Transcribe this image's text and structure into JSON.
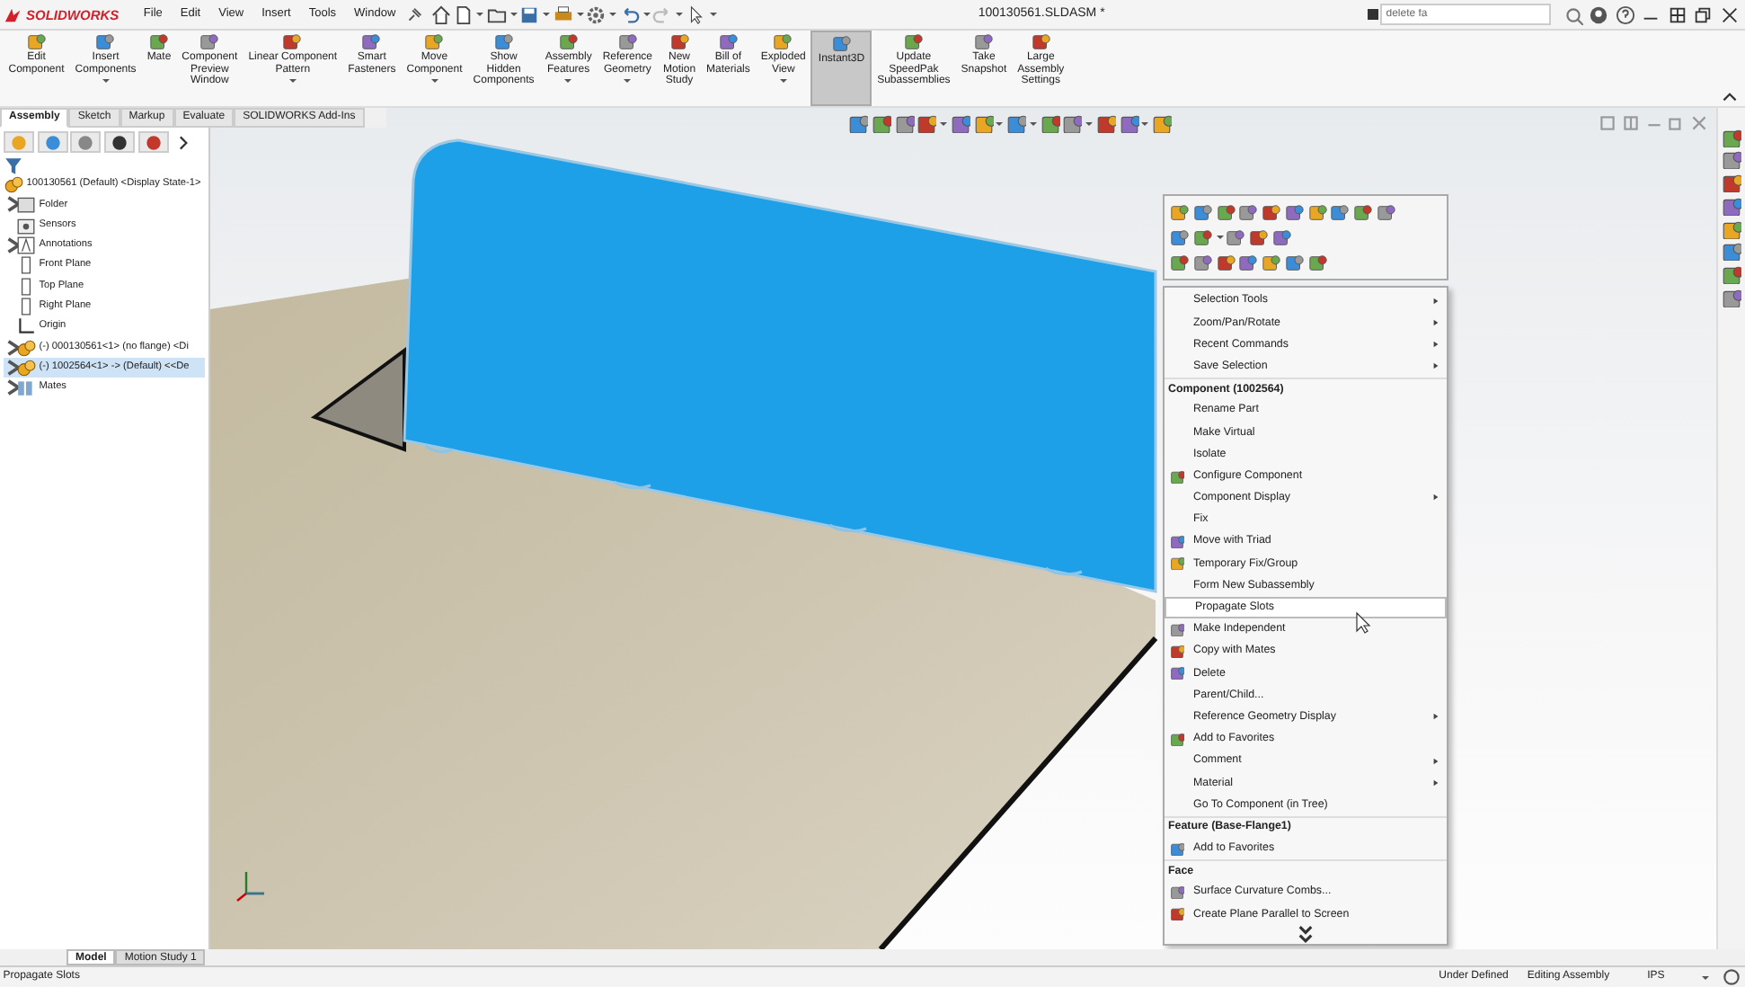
{
  "app": {
    "logo": "SOLIDWORKS",
    "menus": [
      "File",
      "Edit",
      "View",
      "Insert",
      "Tools",
      "Window"
    ],
    "document_title": "100130561.SLDASM *",
    "search": {
      "value": "delete fa"
    }
  },
  "ribbon": {
    "buttons": [
      {
        "label": "Edit\nComponent",
        "dropdown": false,
        "selected": false
      },
      {
        "label": "Insert\nComponents",
        "dropdown": true,
        "selected": false
      },
      {
        "label": "Mate",
        "dropdown": false,
        "selected": false
      },
      {
        "label": "Component\nPreview\nWindow",
        "dropdown": false,
        "selected": false
      },
      {
        "label": "Linear Component\nPattern",
        "dropdown": true,
        "selected": false
      },
      {
        "label": "Smart\nFasteners",
        "dropdown": false,
        "selected": false
      },
      {
        "label": "Move\nComponent",
        "dropdown": true,
        "selected": false
      },
      {
        "label": "Show\nHidden\nComponents",
        "dropdown": false,
        "selected": false
      },
      {
        "label": "Assembly\nFeatures",
        "dropdown": true,
        "selected": false
      },
      {
        "label": "Reference\nGeometry",
        "dropdown": true,
        "selected": false
      },
      {
        "label": "New\nMotion\nStudy",
        "dropdown": false,
        "selected": false
      },
      {
        "label": "Bill of\nMaterials",
        "dropdown": false,
        "selected": false
      },
      {
        "label": "Exploded\nView",
        "dropdown": true,
        "selected": false
      },
      {
        "label": "Instant3D",
        "dropdown": false,
        "selected": true
      },
      {
        "label": "Update\nSpeedPak\nSubassemblies",
        "dropdown": false,
        "selected": false
      },
      {
        "label": "Take\nSnapshot",
        "dropdown": false,
        "selected": false
      },
      {
        "label": "Large\nAssembly\nSettings",
        "dropdown": false,
        "selected": false
      }
    ]
  },
  "command_tabs": [
    {
      "label": "Assembly",
      "selected": true
    },
    {
      "label": "Sketch",
      "selected": false
    },
    {
      "label": "Markup",
      "selected": false
    },
    {
      "label": "Evaluate",
      "selected": false
    },
    {
      "label": "SOLIDWORKS Add-Ins",
      "selected": false
    }
  ],
  "feature_tree": {
    "root": {
      "label": "100130561 (Default) <Display State-1>",
      "selected": false,
      "children": [
        {
          "kind": "folder",
          "label": "Folder",
          "expandable": true,
          "selected": false
        },
        {
          "kind": "sensor",
          "label": "Sensors",
          "expandable": false,
          "selected": false
        },
        {
          "kind": "annotation",
          "label": "Annotations",
          "expandable": true,
          "selected": false
        },
        {
          "kind": "plane",
          "label": "Front Plane",
          "expandable": false,
          "selected": false
        },
        {
          "kind": "plane",
          "label": "Top Plane",
          "expandable": false,
          "selected": false
        },
        {
          "kind": "plane",
          "label": "Right Plane",
          "expandable": false,
          "selected": false
        },
        {
          "kind": "origin",
          "label": "Origin",
          "expandable": false,
          "selected": false
        },
        {
          "kind": "component",
          "label": "(-) 000130561<1> (no flange) <Di",
          "expandable": true,
          "selected": false
        },
        {
          "kind": "component",
          "label": "(-) 1002564<1> -> (Default) <<De",
          "expandable": true,
          "selected": true
        },
        {
          "kind": "mates",
          "label": "Mates",
          "expandable": true,
          "selected": false
        }
      ]
    }
  },
  "context_menu": {
    "items": [
      {
        "kind": "item",
        "label": "Selection Tools",
        "submenu": true,
        "icon": false,
        "selected": false
      },
      {
        "kind": "item",
        "label": "Zoom/Pan/Rotate",
        "submenu": true,
        "icon": false,
        "selected": false
      },
      {
        "kind": "item",
        "label": "Recent Commands",
        "submenu": true,
        "icon": false,
        "selected": false
      },
      {
        "kind": "item",
        "label": "Save Selection",
        "submenu": true,
        "icon": false,
        "selected": false
      },
      {
        "kind": "header",
        "label": "Component (1002564)"
      },
      {
        "kind": "item",
        "label": "Rename Part",
        "submenu": false,
        "icon": false,
        "selected": false
      },
      {
        "kind": "item",
        "label": "Make Virtual",
        "submenu": false,
        "icon": false,
        "selected": false
      },
      {
        "kind": "item",
        "label": "Isolate",
        "submenu": false,
        "icon": false,
        "selected": false
      },
      {
        "kind": "item",
        "label": "Configure Component",
        "submenu": false,
        "icon": true,
        "selected": false
      },
      {
        "kind": "item",
        "label": "Component Display",
        "submenu": true,
        "icon": false,
        "selected": false
      },
      {
        "kind": "item",
        "label": "Fix",
        "submenu": false,
        "icon": false,
        "selected": false
      },
      {
        "kind": "item",
        "label": "Move with Triad",
        "submenu": false,
        "icon": true,
        "selected": false
      },
      {
        "kind": "item",
        "label": "Temporary Fix/Group",
        "submenu": false,
        "icon": true,
        "selected": false
      },
      {
        "kind": "item",
        "label": "Form New Subassembly",
        "submenu": false,
        "icon": false,
        "selected": false
      },
      {
        "kind": "item",
        "label": "Propagate Slots",
        "submenu": false,
        "icon": false,
        "selected": true
      },
      {
        "kind": "item",
        "label": "Make Independent",
        "submenu": false,
        "icon": true,
        "selected": false
      },
      {
        "kind": "item",
        "label": "Copy with Mates",
        "submenu": false,
        "icon": true,
        "selected": false
      },
      {
        "kind": "item",
        "label": "Delete",
        "submenu": false,
        "icon": true,
        "selected": false
      },
      {
        "kind": "item",
        "label": "Parent/Child...",
        "submenu": false,
        "icon": false,
        "selected": false
      },
      {
        "kind": "item",
        "label": "Reference Geometry Display",
        "submenu": true,
        "icon": false,
        "selected": false
      },
      {
        "kind": "item",
        "label": "Add to Favorites",
        "submenu": false,
        "icon": true,
        "selected": false
      },
      {
        "kind": "item",
        "label": "Comment",
        "submenu": true,
        "icon": false,
        "selected": false
      },
      {
        "kind": "item",
        "label": "Material",
        "submenu": true,
        "icon": false,
        "selected": false
      },
      {
        "kind": "item",
        "label": "Go To Component (in Tree)",
        "submenu": false,
        "icon": false,
        "selected": false
      },
      {
        "kind": "header",
        "label": "Feature (Base-Flange1)"
      },
      {
        "kind": "item",
        "label": "Add to Favorites",
        "submenu": false,
        "icon": true,
        "selected": false
      },
      {
        "kind": "header",
        "label": "Face"
      },
      {
        "kind": "item",
        "label": "Surface Curvature Combs...",
        "submenu": false,
        "icon": true,
        "selected": false
      },
      {
        "kind": "item",
        "label": "Create Plane Parallel to Screen",
        "submenu": false,
        "icon": true,
        "selected": false
      },
      {
        "kind": "more"
      }
    ]
  },
  "bottom_tabs": [
    {
      "label": "Model",
      "selected": true
    },
    {
      "label": "Motion Study 1",
      "selected": false
    }
  ],
  "status_bar": {
    "message": "Propagate Slots",
    "state": "Under Defined",
    "mode": "Editing Assembly",
    "units": "IPS"
  }
}
